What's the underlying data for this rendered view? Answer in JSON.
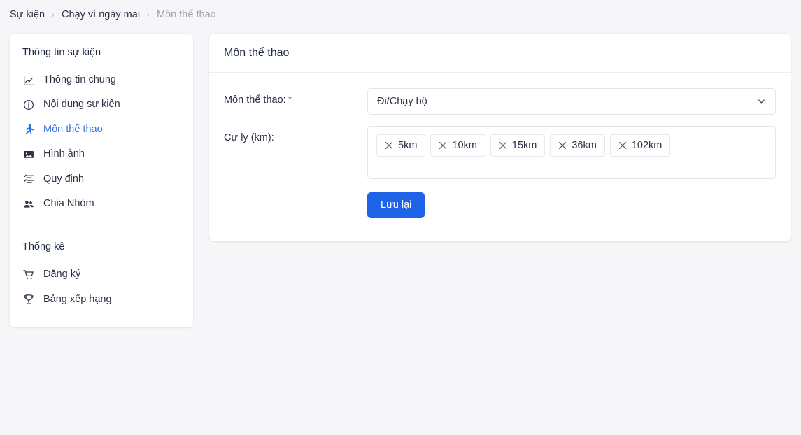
{
  "breadcrumb": {
    "separator": "›",
    "items": [
      {
        "label": "Sự kiện",
        "current": false
      },
      {
        "label": "Chạy vì ngày mai",
        "current": false
      },
      {
        "label": "Môn thể thao",
        "current": true
      }
    ]
  },
  "sidebar": {
    "sections": [
      {
        "title": "Thông tin sự kiện",
        "items": [
          {
            "label": "Thông tin chung",
            "icon": "line-chart-icon",
            "active": false
          },
          {
            "label": "Nội dung sự kiện",
            "icon": "info-circle-icon",
            "active": false
          },
          {
            "label": "Môn thể thao",
            "icon": "running-person-icon",
            "active": true
          },
          {
            "label": "Hình ảnh",
            "icon": "image-icon",
            "active": false
          },
          {
            "label": "Quy định",
            "icon": "ordered-list-icon",
            "active": false
          },
          {
            "label": "Chia Nhóm",
            "icon": "people-group-icon",
            "active": false
          }
        ]
      },
      {
        "title": "Thống kê",
        "items": [
          {
            "label": "Đăng ký",
            "icon": "shopping-cart-icon",
            "active": false
          },
          {
            "label": "Bảng xếp hạng",
            "icon": "trophy-icon",
            "active": false
          }
        ]
      }
    ]
  },
  "main": {
    "card_title": "Môn thể thao",
    "sport_field": {
      "label": "Môn thể thao:",
      "required_mark": "*",
      "value": "Đi/Chạy bộ",
      "arrow_icon": "chevron-down-icon"
    },
    "distance_field": {
      "label": "Cự ly (km):",
      "tags": [
        "5km",
        "10km",
        "15km",
        "36km",
        "102km"
      ],
      "remove_icon": "close-icon"
    },
    "save_button": "Lưu lại"
  },
  "colors": {
    "accent": "#1f64e8",
    "active_nav": "#2f6fe4",
    "required": "#ef4d4d",
    "page_background": "#f6f5f8",
    "card_background": "#ffffff"
  }
}
